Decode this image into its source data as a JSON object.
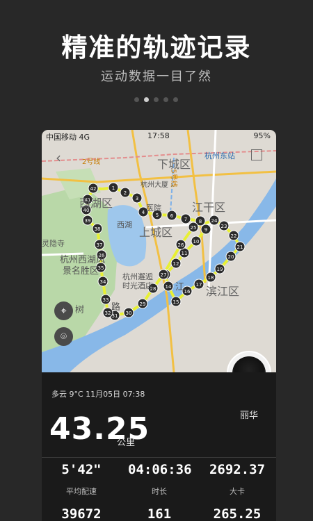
{
  "header": {
    "title": "精准的轨迹记录",
    "subtitle": "运动数据一目了然"
  },
  "carousel": {
    "count": 5,
    "active_index": 1
  },
  "status_bar": {
    "carrier": "中国移动 4G",
    "time": "17:58",
    "battery": "95%"
  },
  "map": {
    "labels": {
      "xiacheng": "下城区",
      "jianggan": "江干区",
      "shangcheng": "上城区",
      "xihu_district": "西湖区",
      "xihu_lake": "西湖",
      "scenic_line1": "杭州西湖风",
      "scenic_line2": "景名胜区",
      "binjiang": "滨江区",
      "hangzhou_east": "杭州东站",
      "hangzhou_tower": "杭州大厦",
      "hospital": "医院",
      "hotel_line1": "杭州邂逅",
      "hotel_line2": "时光酒店",
      "temple": "灵隐寺",
      "qianjiang": "江",
      "tree": "树",
      "metro_line2": "2号线",
      "metro_line5": "5号线",
      "road": "路"
    },
    "route_markers": [
      "1",
      "2",
      "3",
      "4",
      "5",
      "6",
      "7",
      "8",
      "9",
      "10",
      "11",
      "12",
      "13",
      "14",
      "15",
      "16",
      "17",
      "18",
      "19",
      "20",
      "21",
      "22",
      "23",
      "24",
      "25",
      "26",
      "27",
      "28",
      "29",
      "30",
      "31",
      "32",
      "33",
      "34",
      "35",
      "36",
      "37",
      "38",
      "39",
      "40",
      "41",
      "42"
    ],
    "buttons": {
      "locate_icon": "crosshair-icon",
      "map_layer_icon": "map-pin-icon"
    }
  },
  "record": {
    "weather_line": "多云 9°C 11月05日 07:38",
    "user_name": "丽华",
    "distance": "43.25",
    "distance_unit": "公里",
    "stats": [
      {
        "value": "5'42\"",
        "label": "平均配速"
      },
      {
        "value": "04:06:36",
        "label": "时长"
      },
      {
        "value": "2692.37",
        "label": "大卡"
      },
      {
        "value": "39672",
        "label": ""
      },
      {
        "value": "161",
        "label": ""
      },
      {
        "value": "265.25",
        "label": ""
      }
    ]
  },
  "colors": {
    "background": "#282828",
    "route": "#e8f033",
    "marker": "#2b2b2b",
    "river": "#88b8e8"
  }
}
